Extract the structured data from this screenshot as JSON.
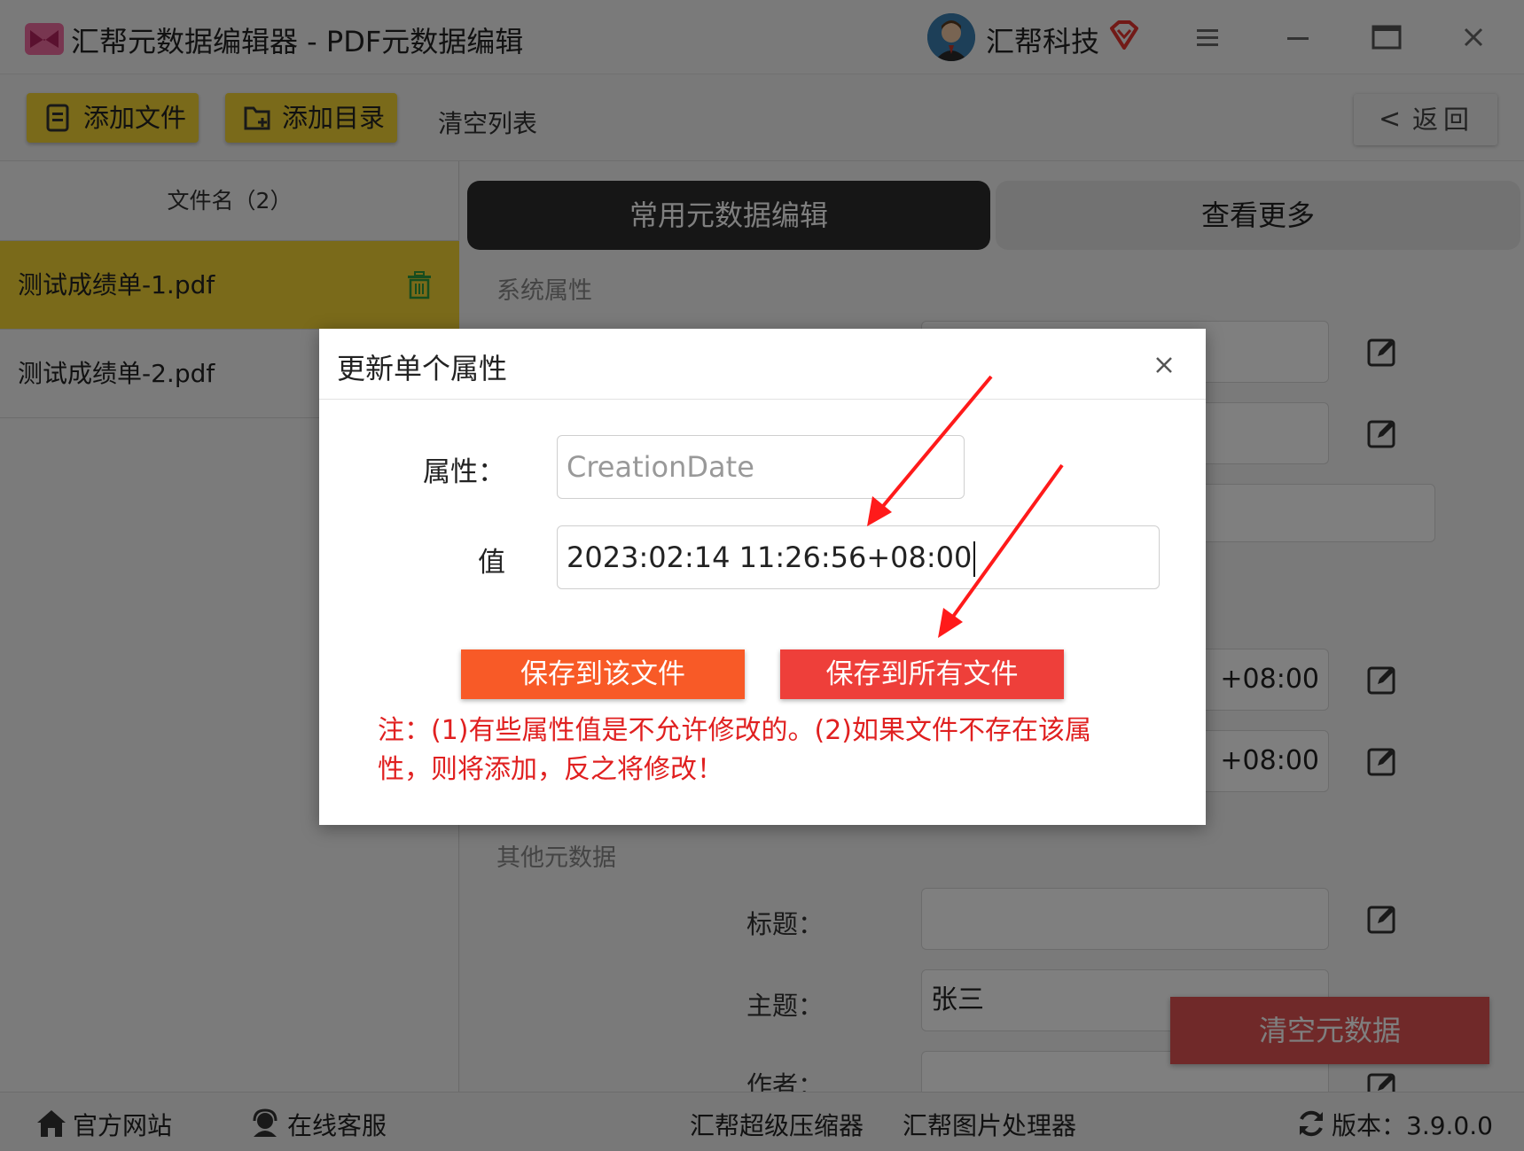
{
  "window": {
    "title": "汇帮元数据编辑器 - PDF元数据编辑",
    "brand": "汇帮科技"
  },
  "toolbar": {
    "add_file": "添加文件",
    "add_dir": "添加目录",
    "clear_list": "清空列表",
    "back": "返回"
  },
  "sidebar": {
    "header": "文件名（2）",
    "files": [
      {
        "name": "测试成绩单-1.pdf",
        "selected": true
      },
      {
        "name": "测试成绩单-2.pdf",
        "selected": false
      }
    ]
  },
  "tabs": {
    "common": "常用元数据编辑",
    "more": "查看更多"
  },
  "main": {
    "system_section": "系统属性",
    "other_section": "其他元数据",
    "date1_tail": "+08:00",
    "date2_tail": "+08:00",
    "fields": {
      "title_label": "标题：",
      "title_value": "",
      "subject_label": "主题：",
      "subject_value": "张三",
      "author_label": "作者："
    },
    "clear_metadata": "清空元数据"
  },
  "dialog": {
    "title": "更新单个属性",
    "property_label": "属性：",
    "property_value": "CreationDate",
    "value_label": "值",
    "value": "2023:02:14 11:26:56+08:00",
    "save_this": "保存到该文件",
    "save_all": "保存到所有文件",
    "note": "注：(1)有些属性值是不允许修改的。(2)如果文件不存在该属性，则将添加，反之将修改！"
  },
  "bottombar": {
    "website": "官方网站",
    "support": "在线客服",
    "compressor": "汇帮超级压缩器",
    "image_tool": "汇帮图片处理器",
    "version": "版本：3.9.0.0"
  },
  "colors": {
    "accent_yellow": "#f4d535",
    "dark_tab": "#2c2c2c",
    "save_this_btn": "#f85a27",
    "save_all_btn": "#ee3f3a",
    "note_red": "#e02020",
    "annotation_arrow": "#ff1a1a"
  }
}
